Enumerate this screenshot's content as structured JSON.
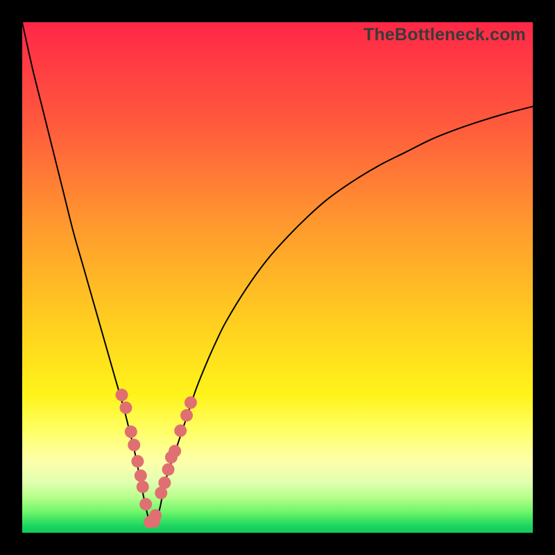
{
  "watermark": {
    "text": "TheBottleneck.com"
  },
  "colors": {
    "frame": "#000000",
    "curve_stroke": "#000000",
    "marker_fill": "#e06f72",
    "gradient_stops": [
      {
        "offset": 0.0,
        "color": "#ff2747"
      },
      {
        "offset": 0.2,
        "color": "#ff5a3d"
      },
      {
        "offset": 0.4,
        "color": "#ff9a2e"
      },
      {
        "offset": 0.6,
        "color": "#ffd21f"
      },
      {
        "offset": 0.73,
        "color": "#fff31a"
      },
      {
        "offset": 0.8,
        "color": "#ffff66"
      },
      {
        "offset": 0.86,
        "color": "#fdffaa"
      },
      {
        "offset": 0.9,
        "color": "#e2ffb0"
      },
      {
        "offset": 0.93,
        "color": "#b8ff8c"
      },
      {
        "offset": 0.96,
        "color": "#6cf56a"
      },
      {
        "offset": 0.985,
        "color": "#1fd861"
      },
      {
        "offset": 1.0,
        "color": "#0ec95b"
      }
    ]
  },
  "chart_data": {
    "type": "line",
    "title": "",
    "xlabel": "",
    "ylabel": "",
    "xlim": [
      0,
      100
    ],
    "ylim": [
      0,
      100
    ],
    "series": [
      {
        "name": "bottleneck-curve",
        "x": [
          0,
          2,
          4,
          6,
          8,
          10,
          12,
          14,
          16,
          18,
          20,
          21,
          22,
          23,
          24,
          25,
          26,
          27,
          28,
          30,
          32,
          34,
          36,
          38,
          40,
          44,
          48,
          52,
          56,
          60,
          65,
          70,
          75,
          80,
          85,
          90,
          95,
          100
        ],
        "y": [
          100,
          91,
          83,
          75,
          67,
          59,
          52,
          45,
          38,
          31,
          24,
          20,
          16,
          11,
          6,
          2,
          2,
          5,
          10,
          16,
          22,
          28,
          33,
          37.5,
          41.5,
          48,
          53.5,
          58,
          62,
          65.5,
          69,
          72,
          74.5,
          77,
          79,
          80.7,
          82.2,
          83.5
        ]
      }
    ],
    "markers": {
      "name": "highlighted-points",
      "x": [
        19.5,
        20.3,
        21.3,
        21.9,
        22.6,
        23.2,
        23.6,
        24.2,
        25.0,
        25.8,
        26.1,
        27.2,
        27.9,
        28.6,
        29.2,
        29.9,
        31.0,
        32.2,
        33.0
      ],
      "y": [
        27.0,
        24.5,
        19.8,
        17.2,
        14.0,
        11.2,
        9.0,
        5.6,
        2.1,
        2.2,
        3.4,
        7.8,
        9.8,
        12.4,
        14.8,
        16.0,
        20.0,
        23.0,
        25.5
      ]
    }
  }
}
